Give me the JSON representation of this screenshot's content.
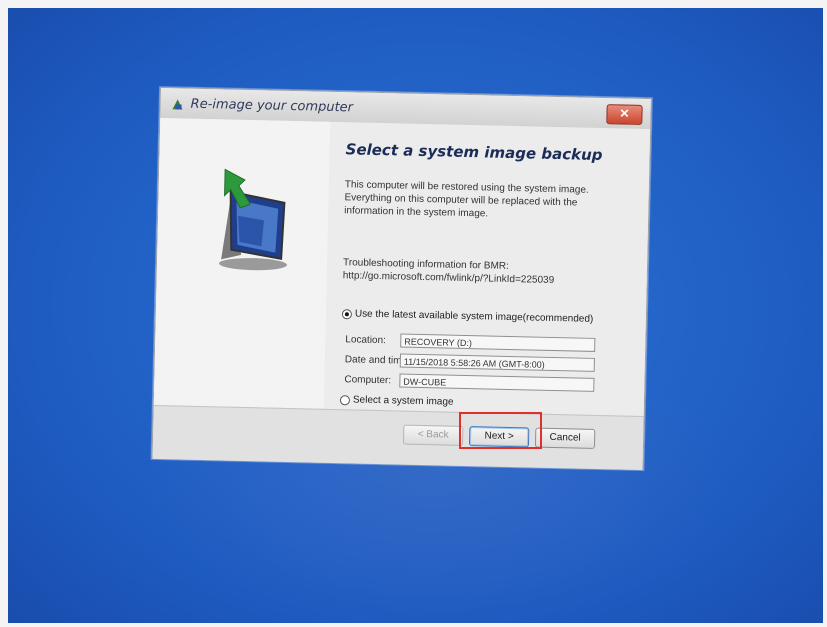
{
  "window": {
    "title": "Re-image your computer",
    "close_label": "✕"
  },
  "page": {
    "heading": "Select a system image backup",
    "description": "This computer will be restored using the system image. Everything on this computer will be replaced with the information in the system image.",
    "troubleshoot_label": "Troubleshooting information for BMR:",
    "troubleshoot_link": "http://go.microsoft.com/fwlink/p/?LinkId=225039"
  },
  "options": {
    "latest_label": "Use the latest available system image(recommended)",
    "select_label": "Select a system image"
  },
  "details": {
    "location_label": "Location:",
    "location_value": "RECOVERY (D:)",
    "datetime_label": "Date and time:",
    "datetime_value": "11/15/2018 5:58:26 AM (GMT-8:00)",
    "computer_label": "Computer:",
    "computer_value": "DW-CUBE"
  },
  "buttons": {
    "back": "< Back",
    "next": "Next >",
    "cancel": "Cancel"
  },
  "colors": {
    "desktop": "#1e5bc0",
    "highlight": "#e0302a"
  },
  "icons": {
    "title_icon": "reimage-icon",
    "graphic": "restore-computer-icon"
  }
}
